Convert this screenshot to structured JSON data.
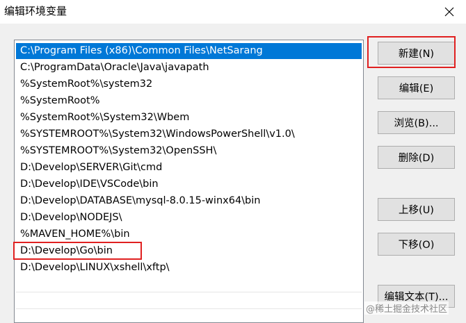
{
  "window": {
    "title": "编辑环境变量"
  },
  "path_list": {
    "selected_index": 0,
    "highlighted_index": 11,
    "items": [
      "C:\\Program Files (x86)\\Common Files\\NetSarang",
      "C:\\ProgramData\\Oracle\\Java\\javapath",
      "%SystemRoot%\\system32",
      "%SystemRoot%",
      "%SystemRoot%\\System32\\Wbem",
      "%SYSTEMROOT%\\System32\\WindowsPowerShell\\v1.0\\",
      "%SYSTEMROOT%\\System32\\OpenSSH\\",
      "D:\\Develop\\SERVER\\Git\\cmd",
      "D:\\Develop\\IDE\\VSCode\\bin",
      "D:\\Develop\\DATABASE\\mysql-8.0.15-winx64\\bin",
      "D:\\Develop\\NODEJS\\",
      "%MAVEN_HOME%\\bin",
      "D:\\Develop\\Go\\bin",
      "D:\\Develop\\LINUX\\xshell\\xftp\\"
    ]
  },
  "buttons": {
    "new": "新建(N)",
    "edit": "编辑(E)",
    "browse": "浏览(B)...",
    "delete": "删除(D)",
    "move_up": "上移(U)",
    "move_down": "下移(O)",
    "edit_text": "编辑文本(T)..."
  },
  "watermark": "@稀土掘金技术社区",
  "colors": {
    "selection": "#0078d7",
    "highlight_box": "#e02020"
  }
}
